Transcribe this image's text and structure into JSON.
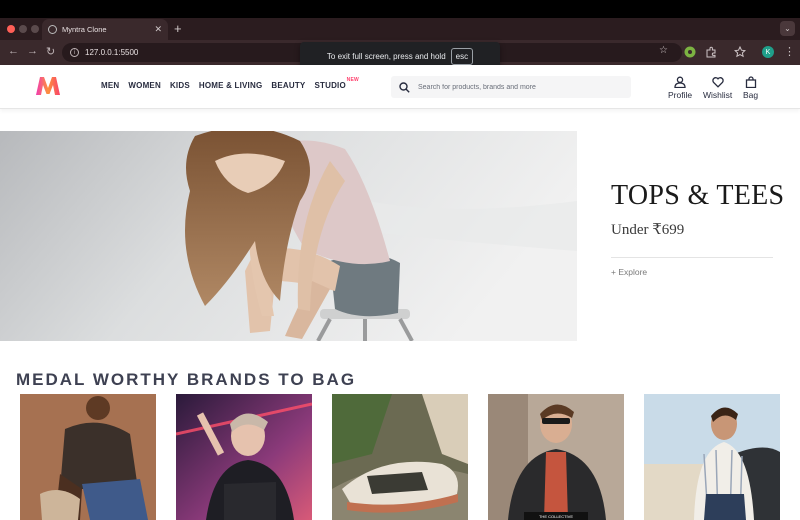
{
  "browser": {
    "tab_title": "Myntra Clone",
    "url": "127.0.0.1:5500",
    "profile_initial": "K",
    "fullscreen_toast": {
      "message": "To exit full screen, press and hold",
      "key": "esc"
    }
  },
  "header": {
    "nav": [
      {
        "label": "MEN"
      },
      {
        "label": "WOMEN"
      },
      {
        "label": "KIDS"
      },
      {
        "label": "HOME & LIVING"
      },
      {
        "label": "BEAUTY"
      },
      {
        "label": "STUDIO",
        "badge": "NEW"
      }
    ],
    "search_placeholder": "Search for products, brands and more",
    "actions": {
      "profile": "Profile",
      "wishlist": "Wishlist",
      "bag": "Bag"
    }
  },
  "hero": {
    "title": "TOPS & TEES",
    "subtitle": "Under ₹699",
    "link": "+ Explore"
  },
  "brands": {
    "title": "MEDAL WORTHY BRANDS TO BAG",
    "card_caption": "THE COLLECTIVE"
  },
  "colors": {
    "brand_pink": "#ff3f6c",
    "text_dark": "#282c3f",
    "section_title": "#3e4152",
    "chrome_bg": "#3a292c"
  }
}
